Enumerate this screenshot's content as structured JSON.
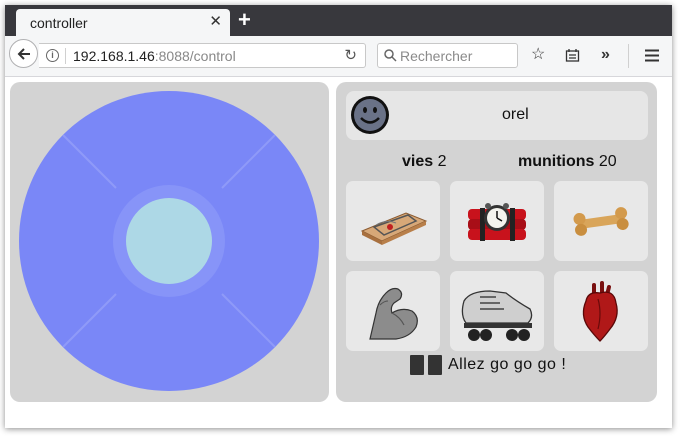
{
  "browser": {
    "tab_title": "controller",
    "tab_close": "✕",
    "new_tab": "+",
    "url_host": "192.168.1.46",
    "url_rest": ":8088/control",
    "search_placeholder": "Rechercher",
    "overflow": "»"
  },
  "player": {
    "name": "orel",
    "lives_label": "vies",
    "lives_value": "2",
    "ammo_label": "munitions",
    "ammo_value": "20"
  },
  "items": [
    {
      "name": "mousetrap",
      "icon": "mousetrap-icon"
    },
    {
      "name": "dynamite bomb",
      "icon": "dynamite-bomb-icon"
    },
    {
      "name": "bone",
      "icon": "bone-icon"
    },
    {
      "name": "muscle arm",
      "icon": "flexed-arm-icon"
    },
    {
      "name": "roller skate",
      "icon": "roller-skate-icon"
    },
    {
      "name": "heart",
      "icon": "anatomical-heart-icon"
    }
  ],
  "status": {
    "message": "Allez go go go !"
  },
  "colors": {
    "joystick_outer": "#7a87f7",
    "joystick_knob": "#add8e6",
    "panel_bg": "#d3d3d3"
  }
}
